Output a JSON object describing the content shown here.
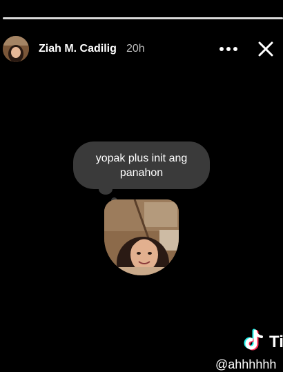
{
  "story": {
    "progress": 1.0,
    "author_name": "Ziah M. Cadilig",
    "timestamp": "20h",
    "more_icon": "more-horizontal-icon",
    "close_icon": "close-icon"
  },
  "note": {
    "text": "yopak plus init ang panahon"
  },
  "watermark": {
    "logo_icon": "tiktok-icon",
    "brand_text": "Ti",
    "handle_text": "@ahhhhhh"
  },
  "colors": {
    "background": "#000000",
    "bubble": "#3a3a3a",
    "progress_track": "#5a5a5a",
    "progress_fill": "#d9d9d9",
    "tiktok_cyan": "#25f4ee",
    "tiktok_red": "#fe2c55"
  }
}
